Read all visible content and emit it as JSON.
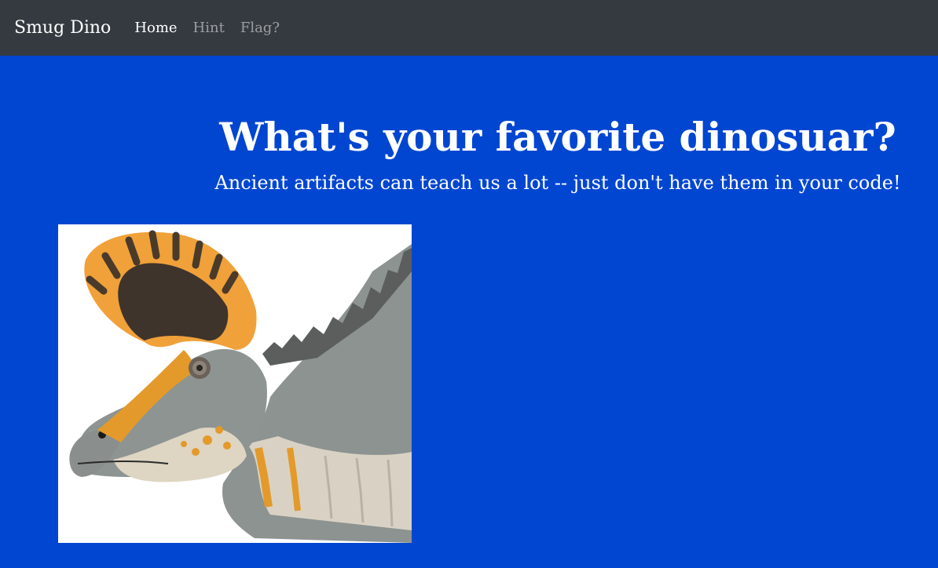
{
  "navbar": {
    "brand": "Smug Dino",
    "links": [
      {
        "label": "Home",
        "active": true
      },
      {
        "label": "Hint",
        "active": false
      },
      {
        "label": "Flag?",
        "active": false
      }
    ]
  },
  "hero": {
    "title": "What's your favorite dinosuar?",
    "subtitle": "Ancient artifacts can teach us a lot -- just don't have them in your code!"
  },
  "image": {
    "subject": "crested hadrosaur head illustration"
  },
  "colors": {
    "navbar_bg": "#343a40",
    "page_bg": "#0046d1",
    "text": "#ffffff"
  }
}
